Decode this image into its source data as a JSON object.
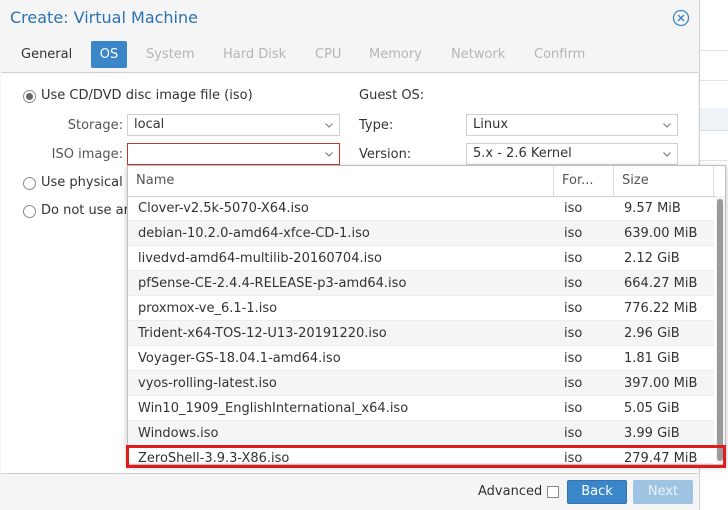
{
  "window": {
    "title": "Create: Virtual Machine",
    "accent_color": "#3a86c8",
    "close_icon": "close-circle-icon"
  },
  "tabs": [
    {
      "label": "General",
      "state": "enabled"
    },
    {
      "label": "OS",
      "state": "active"
    },
    {
      "label": "System",
      "state": "disabled"
    },
    {
      "label": "Hard Disk",
      "state": "disabled"
    },
    {
      "label": "CPU",
      "state": "disabled"
    },
    {
      "label": "Memory",
      "state": "disabled"
    },
    {
      "label": "Network",
      "state": "disabled"
    },
    {
      "label": "Confirm",
      "state": "disabled"
    }
  ],
  "media": {
    "option_iso": "Use CD/DVD disc image file (iso)",
    "option_physical": "Use physical",
    "option_none": "Do not use ar",
    "storage_label": "Storage:",
    "storage_value": "local",
    "iso_label": "ISO image:",
    "iso_value": ""
  },
  "guest_os": {
    "heading": "Guest OS:",
    "type_label": "Type:",
    "type_value": "Linux",
    "version_label": "Version:",
    "version_value": "5.x - 2.6 Kernel"
  },
  "iso_dropdown": {
    "columns": [
      "Name",
      "For...",
      "Size"
    ],
    "rows": [
      {
        "name": "Clover-v2.5k-5070-X64.iso",
        "format": "iso",
        "size": "9.57 MiB"
      },
      {
        "name": "debian-10.2.0-amd64-xfce-CD-1.iso",
        "format": "iso",
        "size": "639.00 MiB"
      },
      {
        "name": "livedvd-amd64-multilib-20160704.iso",
        "format": "iso",
        "size": "2.12 GiB"
      },
      {
        "name": "pfSense-CE-2.4.4-RELEASE-p3-amd64.iso",
        "format": "iso",
        "size": "664.27 MiB"
      },
      {
        "name": "proxmox-ve_6.1-1.iso",
        "format": "iso",
        "size": "776.22 MiB"
      },
      {
        "name": "Trident-x64-TOS-12-U13-20191220.iso",
        "format": "iso",
        "size": "2.96 GiB"
      },
      {
        "name": "Voyager-GS-18.04.1-amd64.iso",
        "format": "iso",
        "size": "1.81 GiB"
      },
      {
        "name": "vyos-rolling-latest.iso",
        "format": "iso",
        "size": "397.00 MiB"
      },
      {
        "name": "Win10_1909_EnglishInternational_x64.iso",
        "format": "iso",
        "size": "5.05 GiB"
      },
      {
        "name": "Windows.iso",
        "format": "iso",
        "size": "3.99 GiB"
      },
      {
        "name": "ZeroShell-3.9.3-X86.iso",
        "format": "iso",
        "size": "279.47 MiB"
      }
    ],
    "highlight_color": "#e11b1b"
  },
  "footer": {
    "advanced_label": "Advanced",
    "back_label": "Back",
    "next_label": "Next"
  }
}
